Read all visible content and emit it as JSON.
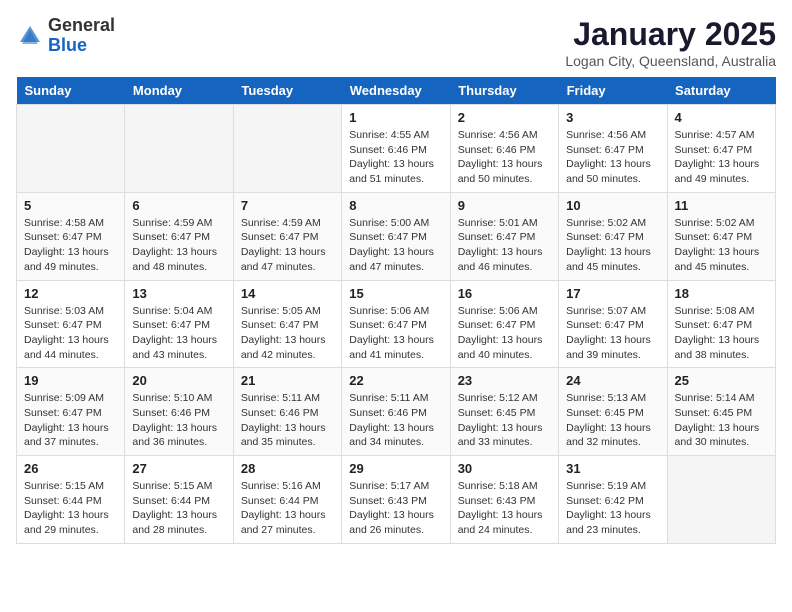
{
  "header": {
    "logo_general": "General",
    "logo_blue": "Blue",
    "month_title": "January 2025",
    "location": "Logan City, Queensland, Australia"
  },
  "days_of_week": [
    "Sunday",
    "Monday",
    "Tuesday",
    "Wednesday",
    "Thursday",
    "Friday",
    "Saturday"
  ],
  "weeks": [
    [
      {
        "day": "",
        "empty": true
      },
      {
        "day": "",
        "empty": true
      },
      {
        "day": "",
        "empty": true
      },
      {
        "day": "1",
        "sunrise": "4:55 AM",
        "sunset": "6:46 PM",
        "daylight": "13 hours and 51 minutes."
      },
      {
        "day": "2",
        "sunrise": "4:56 AM",
        "sunset": "6:46 PM",
        "daylight": "13 hours and 50 minutes."
      },
      {
        "day": "3",
        "sunrise": "4:56 AM",
        "sunset": "6:47 PM",
        "daylight": "13 hours and 50 minutes."
      },
      {
        "day": "4",
        "sunrise": "4:57 AM",
        "sunset": "6:47 PM",
        "daylight": "13 hours and 49 minutes."
      }
    ],
    [
      {
        "day": "5",
        "sunrise": "4:58 AM",
        "sunset": "6:47 PM",
        "daylight": "13 hours and 49 minutes."
      },
      {
        "day": "6",
        "sunrise": "4:59 AM",
        "sunset": "6:47 PM",
        "daylight": "13 hours and 48 minutes."
      },
      {
        "day": "7",
        "sunrise": "4:59 AM",
        "sunset": "6:47 PM",
        "daylight": "13 hours and 47 minutes."
      },
      {
        "day": "8",
        "sunrise": "5:00 AM",
        "sunset": "6:47 PM",
        "daylight": "13 hours and 47 minutes."
      },
      {
        "day": "9",
        "sunrise": "5:01 AM",
        "sunset": "6:47 PM",
        "daylight": "13 hours and 46 minutes."
      },
      {
        "day": "10",
        "sunrise": "5:02 AM",
        "sunset": "6:47 PM",
        "daylight": "13 hours and 45 minutes."
      },
      {
        "day": "11",
        "sunrise": "5:02 AM",
        "sunset": "6:47 PM",
        "daylight": "13 hours and 45 minutes."
      }
    ],
    [
      {
        "day": "12",
        "sunrise": "5:03 AM",
        "sunset": "6:47 PM",
        "daylight": "13 hours and 44 minutes."
      },
      {
        "day": "13",
        "sunrise": "5:04 AM",
        "sunset": "6:47 PM",
        "daylight": "13 hours and 43 minutes."
      },
      {
        "day": "14",
        "sunrise": "5:05 AM",
        "sunset": "6:47 PM",
        "daylight": "13 hours and 42 minutes."
      },
      {
        "day": "15",
        "sunrise": "5:06 AM",
        "sunset": "6:47 PM",
        "daylight": "13 hours and 41 minutes."
      },
      {
        "day": "16",
        "sunrise": "5:06 AM",
        "sunset": "6:47 PM",
        "daylight": "13 hours and 40 minutes."
      },
      {
        "day": "17",
        "sunrise": "5:07 AM",
        "sunset": "6:47 PM",
        "daylight": "13 hours and 39 minutes."
      },
      {
        "day": "18",
        "sunrise": "5:08 AM",
        "sunset": "6:47 PM",
        "daylight": "13 hours and 38 minutes."
      }
    ],
    [
      {
        "day": "19",
        "sunrise": "5:09 AM",
        "sunset": "6:47 PM",
        "daylight": "13 hours and 37 minutes."
      },
      {
        "day": "20",
        "sunrise": "5:10 AM",
        "sunset": "6:46 PM",
        "daylight": "13 hours and 36 minutes."
      },
      {
        "day": "21",
        "sunrise": "5:11 AM",
        "sunset": "6:46 PM",
        "daylight": "13 hours and 35 minutes."
      },
      {
        "day": "22",
        "sunrise": "5:11 AM",
        "sunset": "6:46 PM",
        "daylight": "13 hours and 34 minutes."
      },
      {
        "day": "23",
        "sunrise": "5:12 AM",
        "sunset": "6:45 PM",
        "daylight": "13 hours and 33 minutes."
      },
      {
        "day": "24",
        "sunrise": "5:13 AM",
        "sunset": "6:45 PM",
        "daylight": "13 hours and 32 minutes."
      },
      {
        "day": "25",
        "sunrise": "5:14 AM",
        "sunset": "6:45 PM",
        "daylight": "13 hours and 30 minutes."
      }
    ],
    [
      {
        "day": "26",
        "sunrise": "5:15 AM",
        "sunset": "6:44 PM",
        "daylight": "13 hours and 29 minutes."
      },
      {
        "day": "27",
        "sunrise": "5:15 AM",
        "sunset": "6:44 PM",
        "daylight": "13 hours and 28 minutes."
      },
      {
        "day": "28",
        "sunrise": "5:16 AM",
        "sunset": "6:44 PM",
        "daylight": "13 hours and 27 minutes."
      },
      {
        "day": "29",
        "sunrise": "5:17 AM",
        "sunset": "6:43 PM",
        "daylight": "13 hours and 26 minutes."
      },
      {
        "day": "30",
        "sunrise": "5:18 AM",
        "sunset": "6:43 PM",
        "daylight": "13 hours and 24 minutes."
      },
      {
        "day": "31",
        "sunrise": "5:19 AM",
        "sunset": "6:42 PM",
        "daylight": "13 hours and 23 minutes."
      },
      {
        "day": "",
        "empty": true
      }
    ]
  ]
}
